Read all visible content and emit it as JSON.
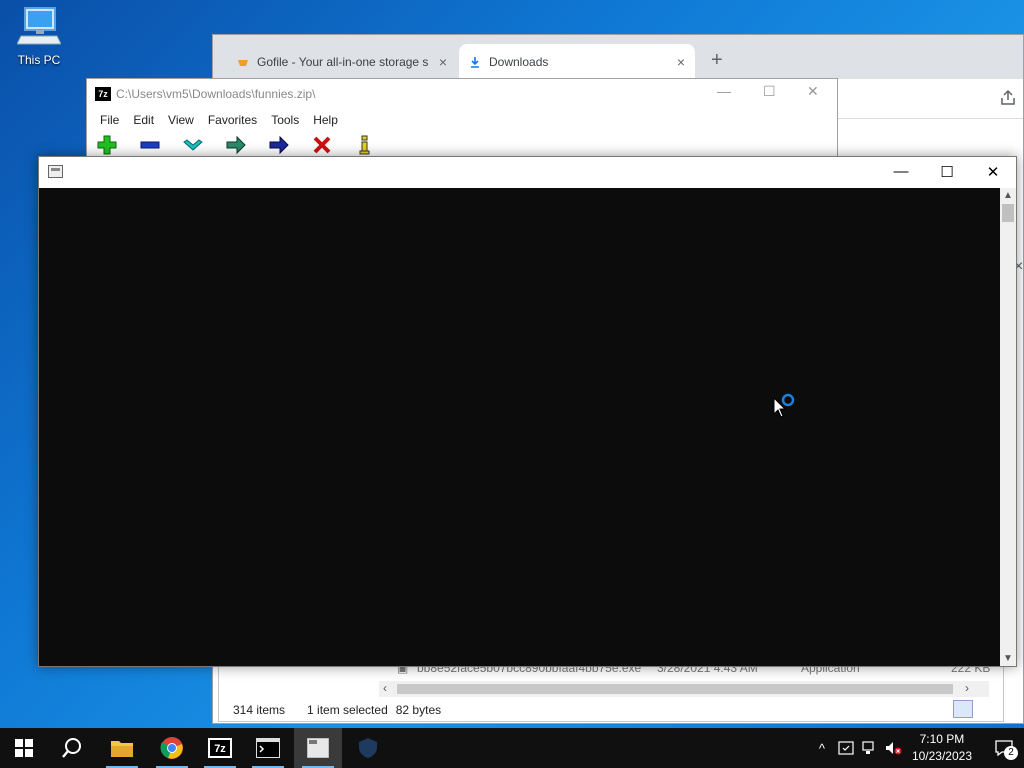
{
  "desktop": {
    "icon_label": "This PC"
  },
  "chrome": {
    "tabs": [
      {
        "title": "Gofile - Your all-in-one storage s",
        "icon": "gofile-icon"
      },
      {
        "title": "Downloads",
        "icon": "download-icon"
      }
    ],
    "close_glyph": "×",
    "newtab_glyph": "+"
  },
  "explorer": {
    "file_row": {
      "name": "bb8e52face5b07bcc890bbfaaf4bb75e.exe",
      "date": "3/28/2021 4:43 AM",
      "type": "Application",
      "size": "222 KB"
    },
    "status": {
      "item_count": "314 items",
      "selected": "1 item selected",
      "size": "82 bytes"
    }
  },
  "sevenzip": {
    "title": "C:\\Users\\vm5\\Downloads\\funnies.zip\\",
    "logo": "7z",
    "menu": [
      "File",
      "Edit",
      "View",
      "Favorites",
      "Tools",
      "Help"
    ],
    "toolbar": [
      "add",
      "extract",
      "test",
      "copy",
      "move",
      "delete",
      "info"
    ]
  },
  "console": {
    "title": ""
  },
  "taskbar": {
    "apps": [
      "start",
      "search",
      "file-explorer",
      "chrome",
      "7-zip",
      "cmd",
      "console-window",
      "app-shield"
    ],
    "clock_time": "7:10 PM",
    "clock_date": "10/23/2023",
    "notification_count": "2"
  },
  "colors": {
    "desktop_blue": "#0f78d4",
    "console_black": "#0c0c0c",
    "taskbar": "#101010",
    "accent": "#76b9ed"
  }
}
